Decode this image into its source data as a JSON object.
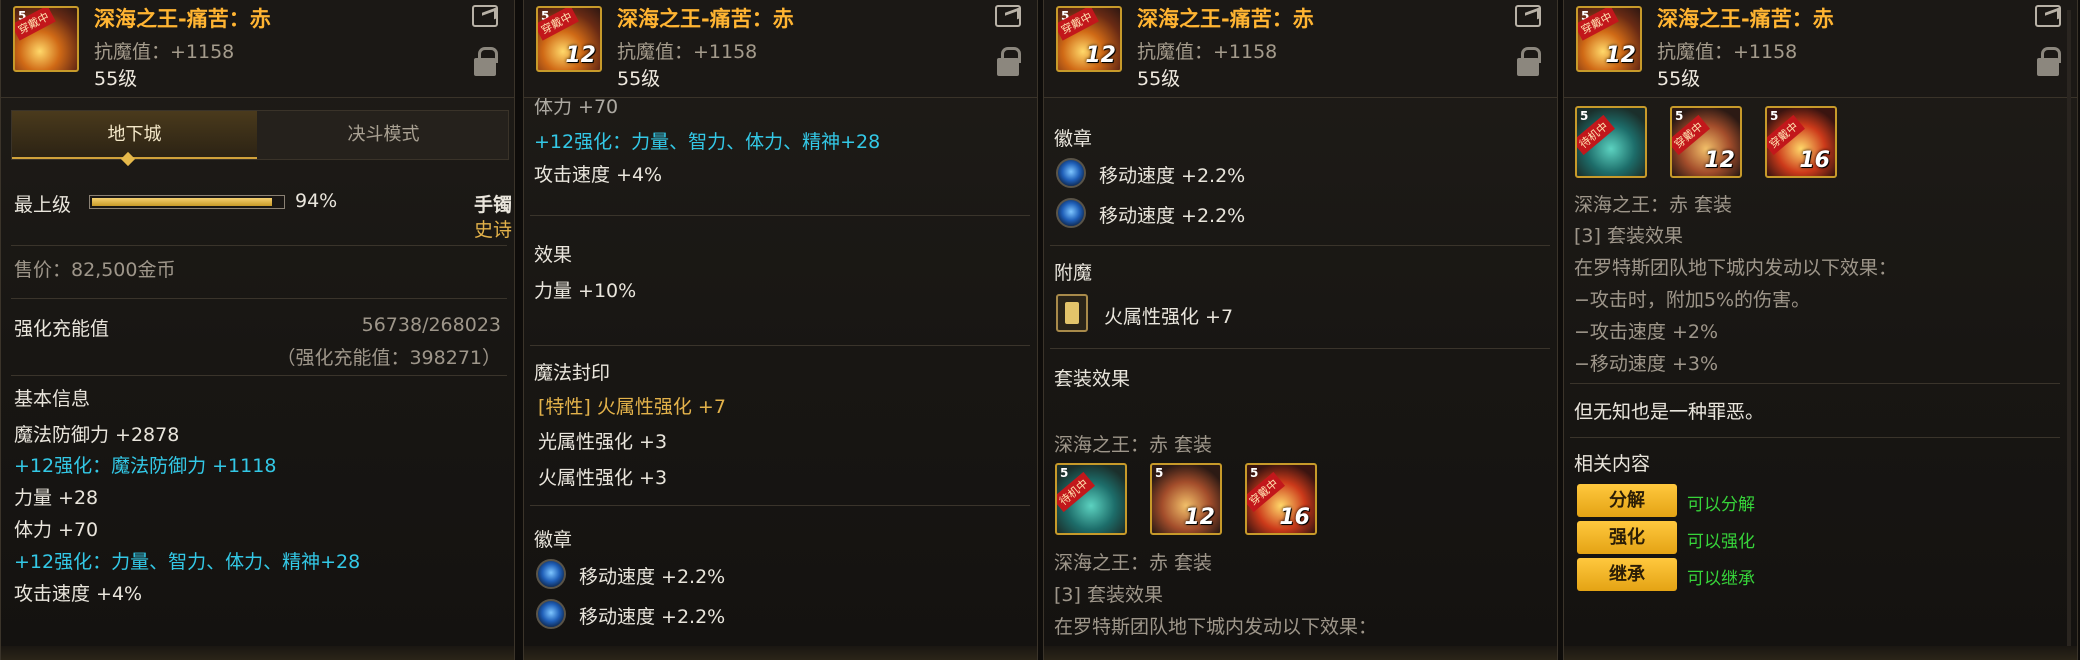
{
  "item": {
    "name": "深海之王-痛苦：赤",
    "resist": "抗魔值：+1158",
    "level": "55级",
    "icon_corner": "5",
    "icon_tag": "穿戴中",
    "icon_num": "12"
  },
  "panel1": {
    "tabs": [
      "地下城",
      "决斗模式"
    ],
    "grade_label": "最上级",
    "grade_percent_text": "94%",
    "grade_fraction": 0.94,
    "slot_type": "手镯",
    "rarity": "史诗",
    "price": "售价：82,500金币",
    "charge_label": "强化充能值",
    "charge_value": "56738/268023",
    "charge_total": "（强化充能值：398271）",
    "basic_header": "基本信息",
    "stats": [
      "魔法防御力 +2878",
      "+12强化：魔法防御力 +1118",
      "力量 +28",
      "体力 +70",
      "+12强化：力量、智力、体力、精神+28",
      "攻击速度 +4%"
    ]
  },
  "panel2": {
    "clipped_top": "体力 +70",
    "reinforce": "+12强化：力量、智力、体力、精神+28",
    "atk_speed": "攻击速度 +4%",
    "effect_header": "效果",
    "effect_value": "力量 +10%",
    "seal_header": "魔法封印",
    "seal_lines": [
      "[特性] 火属性强化 +7",
      "光属性强化 +3",
      "火属性强化 +3"
    ],
    "emblem_header": "徽章",
    "emblems": [
      "移动速度 +2.2%",
      "移动速度 +2.2%"
    ]
  },
  "panel3": {
    "emblem_header": "徽章",
    "emblems": [
      "移动速度 +2.2%",
      "移动速度 +2.2%"
    ],
    "enchant_header": "附魔",
    "enchant_value": "火属性强化 +7",
    "set_header": "套装效果",
    "set_name": "深海之王：赤 套装",
    "set_icons": [
      {
        "corner": "5",
        "tag": "待机中",
        "num": ""
      },
      {
        "corner": "5",
        "tag": "",
        "num": "12"
      },
      {
        "corner": "5",
        "tag": "穿戴中",
        "num": "16"
      }
    ],
    "set_name_2": "深海之王：赤 套装",
    "set_count": "[3] 套装效果",
    "set_desc": "在罗特斯团队地下城内发动以下效果："
  },
  "panel4": {
    "set_icons": [
      {
        "corner": "5",
        "tag": "待机中",
        "num": ""
      },
      {
        "corner": "5",
        "tag": "穿戴中",
        "num": "12"
      },
      {
        "corner": "5",
        "tag": "穿戴中",
        "num": "16"
      }
    ],
    "set_name": "深海之王：赤 套装",
    "set_count": "[3] 套装效果",
    "set_lines": [
      "在罗特斯团队地下城内发动以下效果：",
      "−攻击时，附加5%的伤害。",
      "−攻击速度 +2%",
      "−移动速度 +3%"
    ],
    "flavor": "但无知也是一种罪恶。",
    "related_header": "相关内容",
    "actions": [
      {
        "label": "分解",
        "note": "可以分解"
      },
      {
        "label": "强化",
        "note": "可以强化"
      },
      {
        "label": "继承",
        "note": "可以继承"
      }
    ]
  }
}
